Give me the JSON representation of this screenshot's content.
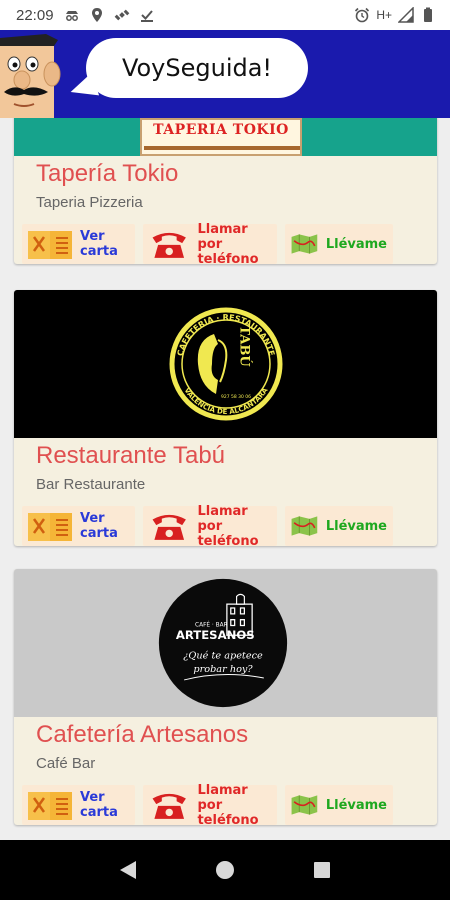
{
  "status_bar": {
    "time": "22:09",
    "network": "H+",
    "left_icons": [
      "incognito-icon",
      "location-icon",
      "satellite-icon",
      "download-done-icon"
    ],
    "right_icons": [
      "alarm-icon",
      "signal-icon",
      "battery-icon"
    ]
  },
  "header": {
    "app_name": "VoySeguida!",
    "background_color": "#1a1aad"
  },
  "restaurants": [
    {
      "name": "Tapería Tokio",
      "category": "Taperia Pizzeria",
      "logo_text": "TAPERIA TOKIO",
      "actions": {
        "menu": [
          "Ver",
          "carta"
        ],
        "call": [
          "Llamar por",
          "teléfono"
        ],
        "directions": [
          "Llévame"
        ]
      }
    },
    {
      "name": "Restaurante Tabú",
      "category": "Bar Restaurante",
      "logo_top_text": "CAFETERIA · RESTAURANTE",
      "logo_vertical_text": "TABÚ",
      "logo_bottom_text": "VALENCIA DE ALCÁNTARA",
      "logo_phone": "927 58 30 06",
      "actions": {
        "menu": [
          "Ver",
          "carta"
        ],
        "call": [
          "Llamar por",
          "teléfono"
        ],
        "directions": [
          "Llévame"
        ]
      }
    },
    {
      "name": "Cafetería Artesanos",
      "category": "Café Bar",
      "logo_top_text": "CAFÉ · BAR",
      "logo_main_text": "ARTESANOS",
      "logo_slogan": [
        "¿Qué te apetece",
        "probar hoy?"
      ],
      "actions": {
        "menu": [
          "Ver",
          "carta"
        ],
        "call": [
          "Llamar por",
          "teléfono"
        ],
        "directions": [
          "Llévame"
        ]
      }
    }
  ],
  "colors": {
    "card_bg": "#f5f0e0",
    "title": "#e05050",
    "menu_label": "#2a3ad8",
    "call_label": "#e02828",
    "directions_label": "#1fa81f"
  }
}
